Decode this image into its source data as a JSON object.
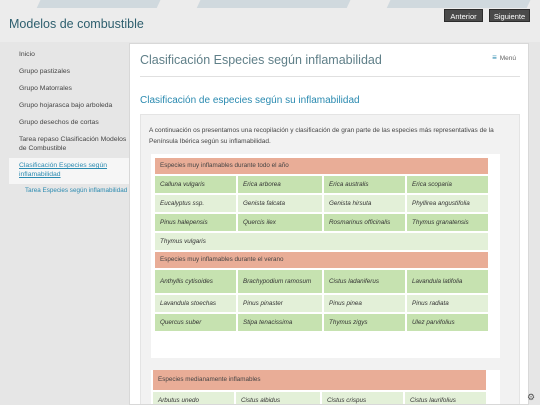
{
  "header": {
    "site_title": "Modelos de combustible",
    "prev_label": "Anterior",
    "next_label": "Siguiente"
  },
  "sidebar": {
    "items": [
      {
        "label": "Inicio"
      },
      {
        "label": "Grupo pastizales"
      },
      {
        "label": "Grupo Matorrales"
      },
      {
        "label": "Grupo hojarasca bajo arboleda"
      },
      {
        "label": "Grupo desechos de cortas"
      },
      {
        "label": "Tarea repaso Clasificación Modelos de Combustible"
      },
      {
        "label": "Clasificación Especies según inflamabilidad"
      }
    ],
    "subitem": "Tarea Especies según inflamabilidad"
  },
  "page": {
    "title": "Clasificación Especies según inflamabilidad",
    "menu_label": "Menú",
    "subtitle": "Clasificación de especies según su inflamabilidad",
    "intro": "A continuación os presentamos una recopilación y clasificación de gran parte de las especies más representativas de la Península Ibérica según su inflamabilidad."
  },
  "table1": {
    "header": "Especies muy inflamables durante todo el año",
    "rows": [
      [
        "Calluna vulgaris",
        "Erica arborea",
        "Erica australis",
        "Erica scoparia"
      ],
      [
        "Eucalyptus ssp.",
        "Genista falcata",
        "Genista hirsuta",
        "Phyllirea angustifolia"
      ],
      [
        "Pinus halepensis",
        "Quercis ilex",
        "Rosmarinus officinalis",
        "Thymus granatensis"
      ],
      [
        "Thymus vulgaris"
      ]
    ]
  },
  "table2": {
    "header": "Especies muy inflamables durante el verano",
    "rows": [
      [
        "Anthyllis cytisoides",
        "Brachypodium ramosum",
        "Cistus ladaniferus",
        "Lavandula latifolia"
      ],
      [
        "Lavandula stoechas",
        "Pinus pinaster",
        "Pinus pinea",
        "Pinus radiata"
      ],
      [
        "Quercus suber",
        "Stipa tenacissima",
        "Thymus zigys",
        "Ulez parvifolius"
      ]
    ]
  },
  "table3": {
    "header": "Especies medianamente inflamables",
    "rows": [
      [
        "Arbutus unedo",
        "Cistus albidus",
        "Cistus crispus",
        "Cistus laurifolius"
      ]
    ]
  },
  "colors": {
    "accent": "#2a8ab0",
    "header_cell": "#e9ad97",
    "green_cell": "#c6e2b0",
    "light_green_cell": "#e3f0d8"
  }
}
